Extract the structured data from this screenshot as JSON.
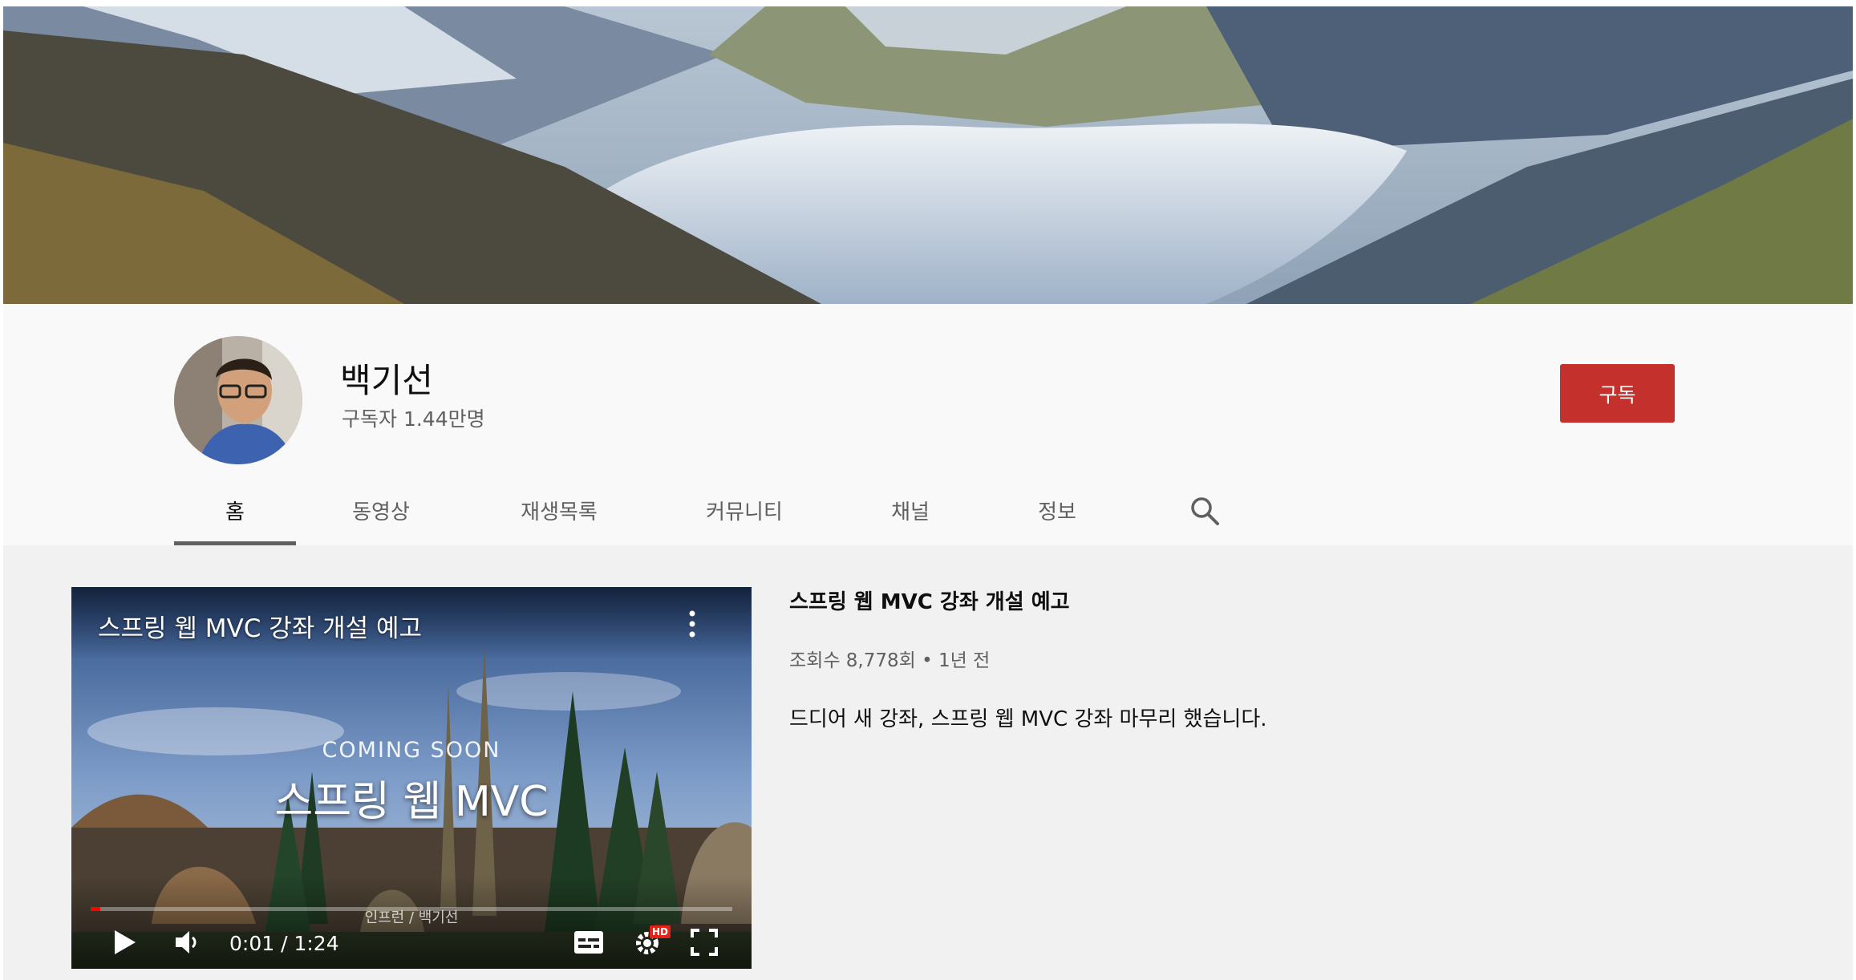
{
  "channel": {
    "name": "백기선",
    "subscribers": "구독자 1.44만명",
    "subscribe_label": "구독"
  },
  "tabs": [
    {
      "label": "홈",
      "active": true
    },
    {
      "label": "동영상",
      "active": false
    },
    {
      "label": "재생목록",
      "active": false
    },
    {
      "label": "커뮤니티",
      "active": false
    },
    {
      "label": "채널",
      "active": false
    },
    {
      "label": "정보",
      "active": false
    }
  ],
  "featured_video": {
    "player_title": "스프링 웹 MVC 강좌 개설 예고",
    "overlay_subtitle": "COMING SOON",
    "overlay_title": "스프링 웹 MVC",
    "watermark": "인프런 / 백기선",
    "time": "0:01 / 1:24",
    "progress_fraction": 0.015,
    "hd_badge": "HD",
    "title": "스프링 웹 MVC 강좌 개설 예고",
    "meta": "조회수 8,778회 • 1년 전",
    "description": "드디어 새 강좌, 스프링 웹 MVC 강좌 마무리 했습니다."
  },
  "colors": {
    "subscribe": "#c4302b",
    "progress": "#ff0000",
    "hd_badge": "#e62117"
  },
  "icons": [
    "search-icon",
    "more-vert-icon",
    "play-icon",
    "volume-icon",
    "subtitles-icon",
    "settings-icon",
    "fullscreen-icon"
  ]
}
